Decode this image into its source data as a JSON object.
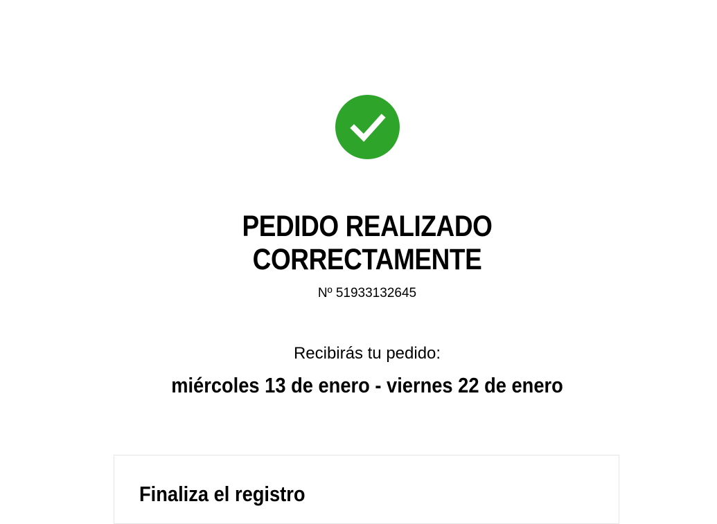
{
  "confirmation": {
    "icon": "check-circle-icon",
    "accent_color": "#2ea52a",
    "title_line1": "PEDIDO REALIZADO",
    "title_line2": "CORRECTAMENTE",
    "order_number": "Nº 51933132645"
  },
  "delivery": {
    "label": "Recibirás tu pedido:",
    "dates": "miércoles 13 de enero - viernes 22 de enero"
  },
  "register": {
    "title": "Finaliza el registro"
  }
}
